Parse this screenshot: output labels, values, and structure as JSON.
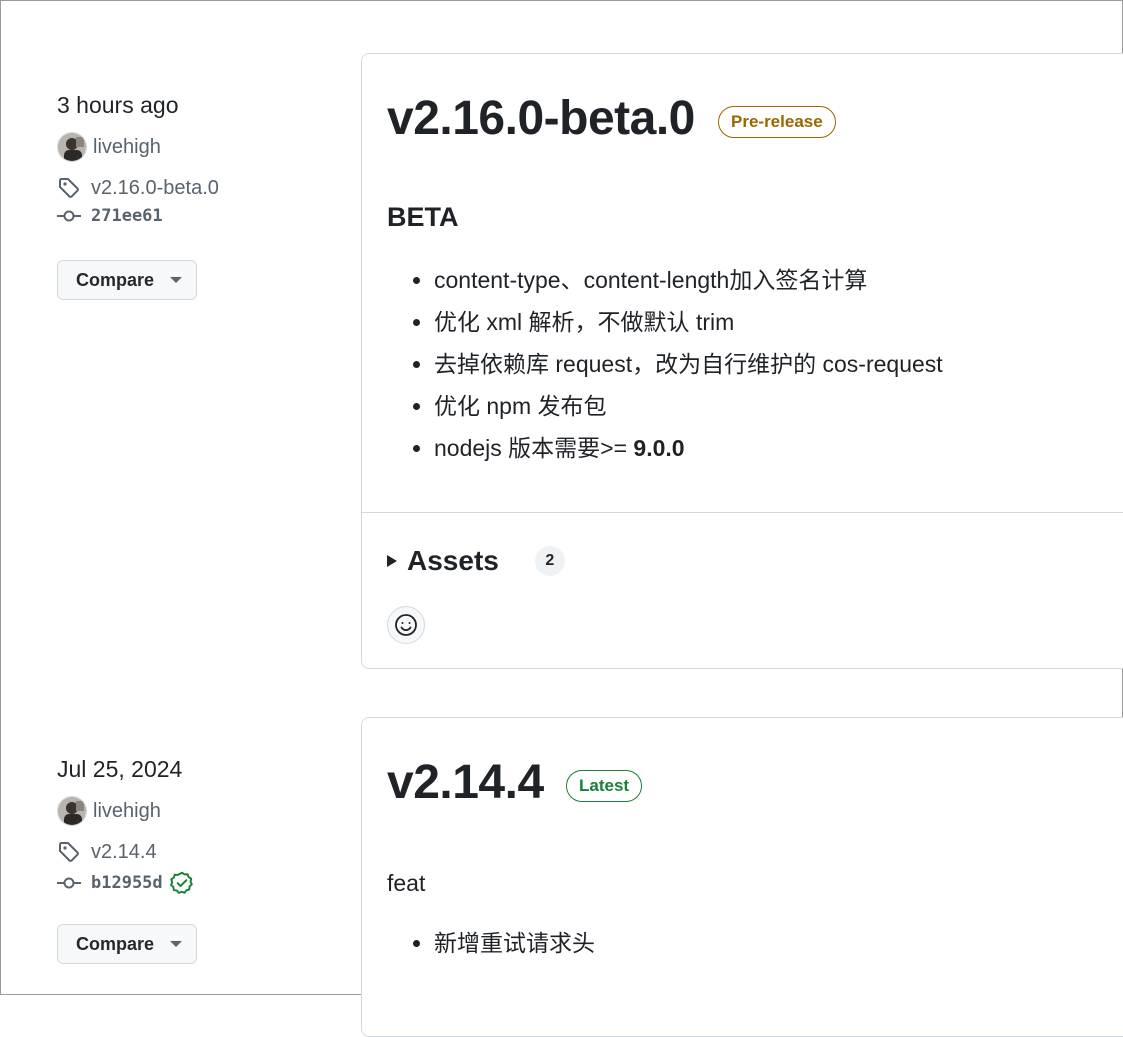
{
  "releases": [
    {
      "date": "3 hours ago",
      "author": "livehigh",
      "tag": "v2.16.0-beta.0",
      "commit": "271ee61",
      "compare_label": "Compare",
      "title": "v2.16.0-beta.0",
      "badge": "Pre-release",
      "heading": "BETA",
      "notes": [
        "content-type、content-length加入签名计算",
        "优化 xml 解析，不做默认 trim",
        "去掉依赖库 request，改为自行维护的 cos-request",
        "优化 npm 发布包",
        "nodejs 版本需要>= "
      ],
      "note_bold": "9.0.0",
      "assets_label": "Assets",
      "assets_count": "2"
    },
    {
      "date": "Jul 25, 2024",
      "author": "livehigh",
      "tag": "v2.14.4",
      "commit": "b12955d",
      "compare_label": "Compare",
      "title": "v2.14.4",
      "badge": "Latest",
      "intro": "feat",
      "notes": [
        "新增重试请求头"
      ]
    }
  ],
  "icons": {
    "tag": "tag-icon",
    "commit": "git-commit-icon",
    "verified": "verified-check-icon",
    "smiley": "smiley-icon"
  },
  "colors": {
    "prerelease": "#9a6700",
    "latest": "#1a7f37",
    "muted": "#59636e"
  }
}
